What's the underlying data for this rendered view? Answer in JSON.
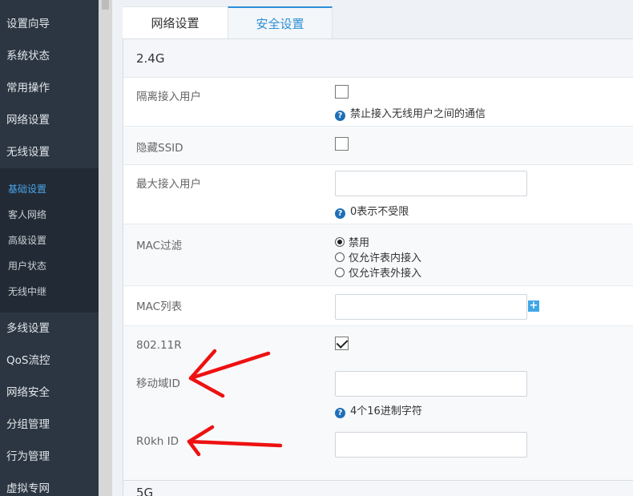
{
  "sidebar": {
    "items_top": [
      "设置向导",
      "系统状态",
      "常用操作",
      "网络设置",
      "无线设置"
    ],
    "submenu": [
      "基础设置",
      "客人网络",
      "高级设置",
      "用户状态",
      "无线中继"
    ],
    "active_submenu_index": 0,
    "items_bottom": [
      "多线设置",
      "QoS流控",
      "网络安全",
      "分组管理",
      "行为管理",
      "虚拟专网"
    ]
  },
  "tabs": {
    "network": "网络设置",
    "security": "安全设置",
    "active": "security"
  },
  "section_24g": {
    "title": "2.4G",
    "isolate_users": {
      "label": "隔离接入用户",
      "checked": false,
      "hint": "禁止接入无线用户之间的通信"
    },
    "hide_ssid": {
      "label": "隐藏SSID",
      "checked": false
    },
    "max_users": {
      "label": "最大接入用户",
      "value": "",
      "hint": "0表示不受限"
    },
    "mac_filter": {
      "label": "MAC过滤",
      "options": [
        "禁用",
        "仅允许表内接入",
        "仅允许表外接入"
      ],
      "selected": 0
    },
    "mac_list": {
      "label": "MAC列表",
      "value": "",
      "add_label": "+"
    },
    "r80211": {
      "label": "802.11R",
      "checked": true
    },
    "mobility_domain": {
      "label": "移动域ID",
      "value": "",
      "hint": "4个16进制字符"
    },
    "r0kh": {
      "label": "R0kh ID",
      "value": ""
    }
  },
  "section_5g": {
    "title": "5G"
  },
  "colors": {
    "sidebar_bg": "#2b3642",
    "accent": "#2b8fd6",
    "annotation_arrow": "#ee1111"
  }
}
